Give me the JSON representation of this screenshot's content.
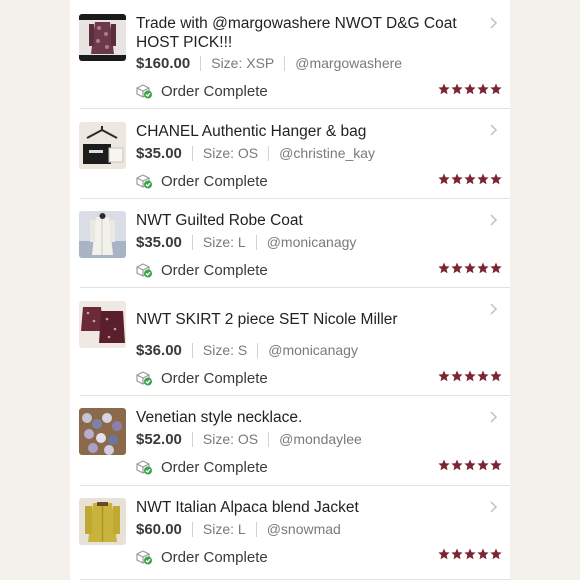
{
  "colors": {
    "star": "#7a2531",
    "status_check": "#3fa34d",
    "chevron": "#c4c2bd"
  },
  "orders": [
    {
      "title": "Trade with @margowashere NWOT D&G Coat HOST PICK!!!",
      "price": "$160.00",
      "size": "Size: XSP",
      "seller": "@margowashere",
      "status": "Order Complete",
      "rating": 5,
      "thumb_icon": "coat-photo"
    },
    {
      "title": "CHANEL Authentic Hanger & bag",
      "price": "$35.00",
      "size": "Size: OS",
      "seller": "@christine_kay",
      "status": "Order Complete",
      "rating": 5,
      "thumb_icon": "hanger-bag-photo"
    },
    {
      "title": "NWT Guilted Robe Coat",
      "price": "$35.00",
      "size": "Size: L",
      "seller": "@monicanagy",
      "status": "Order Complete",
      "rating": 5,
      "thumb_icon": "robe-photo"
    },
    {
      "title": "NWT SKIRT 2 piece SET Nicole Miller",
      "price": "$36.00",
      "size": "Size: S",
      "seller": "@monicanagy",
      "status": "Order Complete",
      "rating": 5,
      "thumb_icon": "skirt-set-photo"
    },
    {
      "title": "Venetian style necklace.",
      "price": "$52.00",
      "size": "Size: OS",
      "seller": "@mondaylee",
      "status": "Order Complete",
      "rating": 5,
      "thumb_icon": "necklace-photo"
    },
    {
      "title": "NWT Italian Alpaca blend Jacket",
      "price": "$60.00",
      "size": "Size: L",
      "seller": "@snowmad",
      "status": "Order Complete",
      "rating": 5,
      "thumb_icon": "jacket-photo"
    }
  ]
}
